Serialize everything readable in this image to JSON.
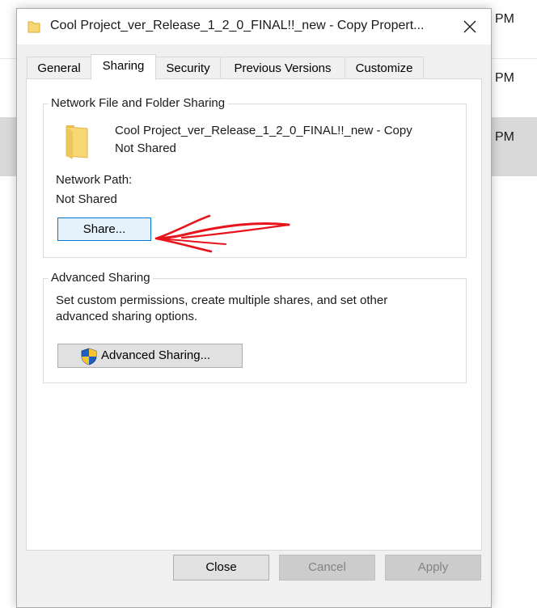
{
  "background": {
    "rows": [
      {
        "time": "PM"
      },
      {
        "time": "PM"
      },
      {
        "time": "PM"
      }
    ]
  },
  "dialog": {
    "title": "Cool Project_ver_Release_1_2_0_FINAL!!_new - Copy Propert...",
    "tabs": [
      {
        "label": "General"
      },
      {
        "label": "Sharing"
      },
      {
        "label": "Security"
      },
      {
        "label": "Previous Versions"
      },
      {
        "label": "Customize"
      }
    ],
    "active_tab": "Sharing",
    "network_sharing": {
      "legend": "Network File and Folder Sharing",
      "folder_name": "Cool Project_ver_Release_1_2_0_FINAL!!_new - Copy",
      "folder_status": "Not Shared",
      "network_path_label": "Network Path:",
      "network_path_value": "Not Shared",
      "share_button": "Share..."
    },
    "advanced_sharing": {
      "legend": "Advanced Sharing",
      "description_line1": "Set custom permissions, create multiple shares, and set other",
      "description_line2": "advanced sharing options.",
      "button": "Advanced Sharing..."
    },
    "buttons": {
      "close": "Close",
      "cancel": "Cancel",
      "apply": "Apply"
    }
  },
  "colors": {
    "accent": "#0078d7",
    "folder": "#f8d775",
    "annotation_arrow": "#e8141c"
  }
}
